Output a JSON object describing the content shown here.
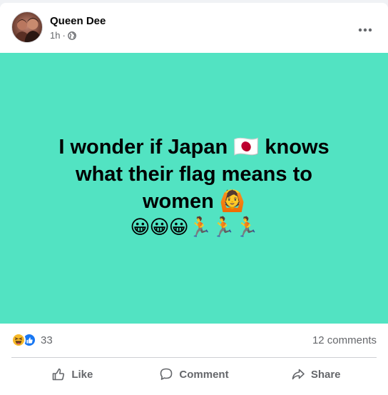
{
  "post": {
    "author": "Queen Dee",
    "timestamp": "1h",
    "separator": "·",
    "audience_icon": "globe-icon",
    "menu_icon": "more-horizontal-icon",
    "background_color": "#52e3c2",
    "text_lines": [
      "I wonder if Japan 🇯🇵 knows",
      "what their flag means to",
      "women 🙆"
    ],
    "emoji_line": "😀😀😀🏃🏃🏃"
  },
  "reactions": {
    "icons": [
      "haha-reaction-icon",
      "like-reaction-icon"
    ],
    "count": "33"
  },
  "comments_count": "12 comments",
  "actions": {
    "like_label": "Like",
    "comment_label": "Comment",
    "share_label": "Share"
  },
  "colors": {
    "secondary_text": "#65676b",
    "like_blue": "#1877f2",
    "haha_yellow": "#f7b928"
  }
}
